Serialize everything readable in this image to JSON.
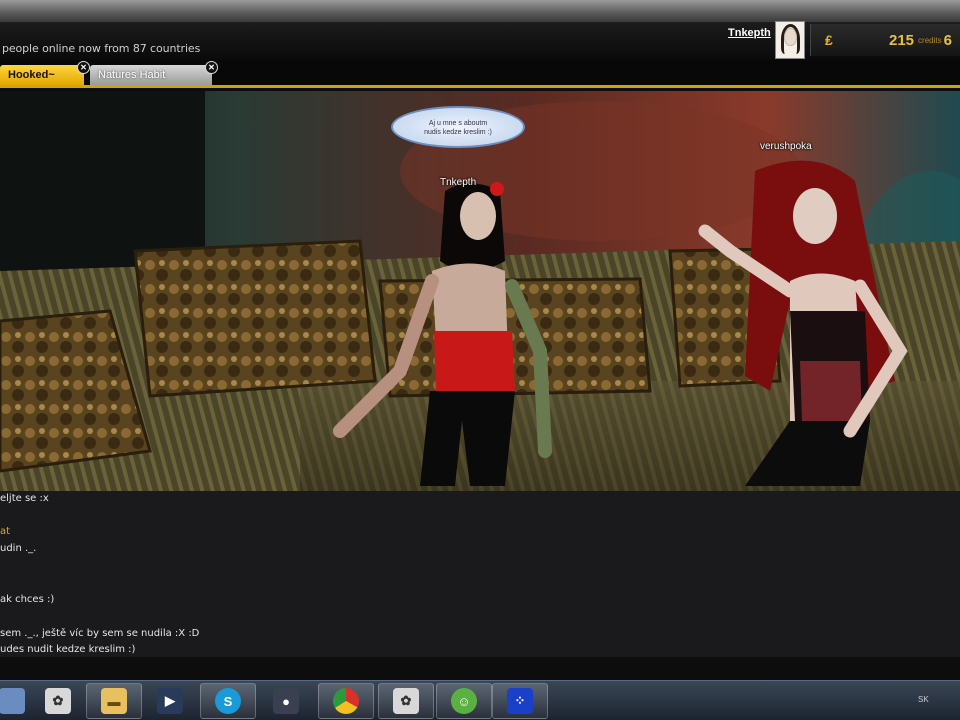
{
  "header": {
    "online_text": "people online now from 87 countries",
    "username": "Tnkepth",
    "credits_amount": "215",
    "credits_label": "credits",
    "credits_cut": "6"
  },
  "tabs": [
    {
      "label": "Hooked~",
      "active": true
    },
    {
      "label": "Natures Habit",
      "active": false
    }
  ],
  "scene": {
    "speech_bubble": "Aj u mne s aboutm\nnudis kedze kreslim :)",
    "avatar_left_name": "Tnkepth",
    "avatar_right_name": "verushpoka"
  },
  "chat": {
    "lines": [
      {
        "text": "eljte se :x",
        "type": "msg"
      },
      {
        "text": "at",
        "type": "name"
      },
      {
        "text": "udin ._.",
        "type": "msg"
      },
      {
        "text": "ak chces :)",
        "type": "msg"
      },
      {
        "text": "sem ._., ještě víc by sem se nudila :X :D",
        "type": "msg"
      },
      {
        "text": "udes nudit kedze kreslim :)",
        "type": "msg"
      }
    ]
  },
  "taskbar": {
    "tray_text": "SK",
    "items": [
      {
        "icon": "imvu-icon"
      },
      {
        "icon": "folder-icon"
      },
      {
        "icon": "media-player-icon"
      },
      {
        "icon": "skype-icon"
      },
      {
        "icon": "app-icon"
      },
      {
        "icon": "chrome-icon"
      },
      {
        "icon": "imvu-icon"
      },
      {
        "icon": "messenger-icon"
      },
      {
        "icon": "game-icon"
      }
    ]
  },
  "colors": {
    "accent": "#d4a300",
    "tab_active": "#ffd640",
    "credits": "#e8c040",
    "chat_bg": "#1a1a1c",
    "taskbar": "#2a3442"
  }
}
